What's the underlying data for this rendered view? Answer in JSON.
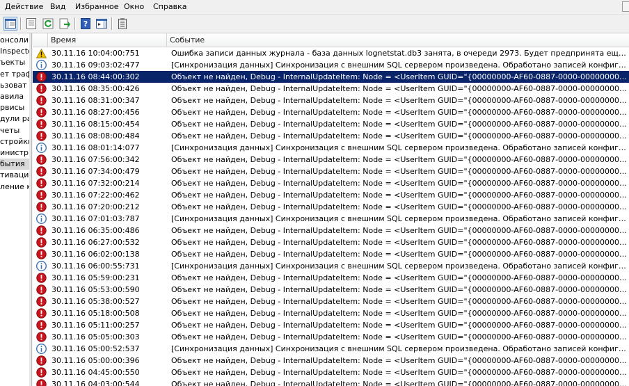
{
  "menu": [
    "Действие",
    "Вид",
    "Избранное",
    "Окно",
    "Справка"
  ],
  "toolbar": {
    "buttons": [
      "console-tree-icon",
      "properties-icon",
      "refresh-icon",
      "export-list-icon",
      "help-icon",
      "action-pane-icon",
      "clipboard-icon"
    ]
  },
  "tree": {
    "items": [
      "онсоли",
      "Inspecto",
      "ъекты",
      "ет траф",
      "ьзоват",
      "авила",
      "рвисы",
      "дули ра",
      "четы",
      "стройки",
      "инистр",
      "бытия",
      "тивация",
      "ление ко"
    ],
    "selected_index": 11
  },
  "columns": {
    "time": "Время",
    "event": "Событие"
  },
  "colors": {
    "selection": "#0a246a",
    "warning": "#f2c200",
    "error": "#c8141d",
    "info": "#3f6fb0"
  },
  "selected_row": 2,
  "rows": [
    {
      "type": "warning",
      "time": "30.11.16 10:04:00:751",
      "message": "Ошибка записи данных журнала - база данных lognetstat.db3 занята, в очереди 2973. Будет предпринята еще одна попыт..."
    },
    {
      "type": "info",
      "time": "30.11.16 09:03:02:477",
      "message": "[Синхронизация данных] Синхронизация с внешним SQL сервером произведена. Обработано записей конфигураци ..."
    },
    {
      "type": "error",
      "time": "30.11.16 08:44:00:302",
      "message": "Объект не найден, Debug - InternalUpdateItem: Node = <UserItem GUID=\"{00000000-AF60-0887-0000-000000000000}\"/>"
    },
    {
      "type": "error",
      "time": "30.11.16 08:35:00:426",
      "message": "Объект не найден, Debug - InternalUpdateItem: Node = <UserItem GUID=\"{00000000-AF60-0887-0000-000000000000}\"/>"
    },
    {
      "type": "error",
      "time": "30.11.16 08:31:00:347",
      "message": "Объект не найден, Debug - InternalUpdateItem: Node = <UserItem GUID=\"{00000000-AF60-0887-0000-000000000000}\"/>"
    },
    {
      "type": "error",
      "time": "30.11.16 08:27:00:456",
      "message": "Объект не найден, Debug - InternalUpdateItem: Node = <UserItem GUID=\"{00000000-AF60-0887-0000-000000000000}\"/>"
    },
    {
      "type": "error",
      "time": "30.11.16 08:15:00:454",
      "message": "Объект не найден, Debug - InternalUpdateItem: Node = <UserItem GUID=\"{00000000-AF60-0887-0000-000000000000}\"/>"
    },
    {
      "type": "error",
      "time": "30.11.16 08:08:00:484",
      "message": "Объект не найден, Debug - InternalUpdateItem: Node = <UserItem GUID=\"{00000000-AF60-0887-0000-000000000000}\"/>"
    },
    {
      "type": "info",
      "time": "30.11.16 08:01:14:077",
      "message": "[Синхронизация данных] Синхронизация с внешним SQL сервером произведена. Обработано записей конфигураци ..."
    },
    {
      "type": "error",
      "time": "30.11.16 07:56:00:342",
      "message": "Объект не найден, Debug - InternalUpdateItem: Node = <UserItem GUID=\"{00000000-AF60-0887-0000-000000000000}\"/>"
    },
    {
      "type": "error",
      "time": "30.11.16 07:34:00:479",
      "message": "Объект не найден, Debug - InternalUpdateItem: Node = <UserItem GUID=\"{00000000-AF60-0887-0000-000000000000}\"/>"
    },
    {
      "type": "error",
      "time": "30.11.16 07:32:00:214",
      "message": "Объект не найден, Debug - InternalUpdateItem: Node = <UserItem GUID=\"{00000000-AF60-0887-0000-000000000000}\"/>"
    },
    {
      "type": "error",
      "time": "30.11.16 07:22:00:462",
      "message": "Объект не найден, Debug - InternalUpdateItem: Node = <UserItem GUID=\"{00000000-AF60-0887-0000-000000000000}\"/>"
    },
    {
      "type": "error",
      "time": "30.11.16 07:20:00:212",
      "message": "Объект не найден, Debug - InternalUpdateItem: Node = <UserItem GUID=\"{00000000-AF60-0887-0000-000000000000}\"/>"
    },
    {
      "type": "info",
      "time": "30.11.16 07:01:03:787",
      "message": "[Синхронизация данных] Синхронизация с внешним SQL сервером произведена. Обработано записей конфигураци ..."
    },
    {
      "type": "error",
      "time": "30.11.16 06:35:00:486",
      "message": "Объект не найден, Debug - InternalUpdateItem: Node = <UserItem GUID=\"{00000000-AF60-0887-0000-000000000000}\"/>"
    },
    {
      "type": "error",
      "time": "30.11.16 06:27:00:532",
      "message": "Объект не найден, Debug - InternalUpdateItem: Node = <UserItem GUID=\"{00000000-AF60-0887-0000-000000000000}\"/>"
    },
    {
      "type": "error",
      "time": "30.11.16 06:02:00:138",
      "message": "Объект не найден, Debug - InternalUpdateItem: Node = <UserItem GUID=\"{00000000-AF60-0887-0000-000000000000}\"/>"
    },
    {
      "type": "info",
      "time": "30.11.16 06:00:55:731",
      "message": "[Синхронизация данных] Синхронизация с внешним SQL сервером произведена. Обработано записей конфигураци ..."
    },
    {
      "type": "error",
      "time": "30.11.16 05:59:00:231",
      "message": "Объект не найден, Debug - InternalUpdateItem: Node = <UserItem GUID=\"{00000000-AF60-0887-0000-000000000000}\"/>"
    },
    {
      "type": "error",
      "time": "30.11.16 05:53:00:590",
      "message": "Объект не найден, Debug - InternalUpdateItem: Node = <UserItem GUID=\"{00000000-AF60-0887-0000-000000000000}\"/>"
    },
    {
      "type": "error",
      "time": "30.11.16 05:38:00:527",
      "message": "Объект не найден, Debug - InternalUpdateItem: Node = <UserItem GUID=\"{00000000-AF60-0887-0000-000000000000}\"/>"
    },
    {
      "type": "error",
      "time": "30.11.16 05:18:00:508",
      "message": "Объект не найден, Debug - InternalUpdateItem: Node = <UserItem GUID=\"{00000000-AF60-0887-0000-000000000000}\"/>"
    },
    {
      "type": "error",
      "time": "30.11.16 05:11:00:257",
      "message": "Объект не найден, Debug - InternalUpdateItem: Node = <UserItem GUID=\"{00000000-AF60-0887-0000-000000000000}\"/>"
    },
    {
      "type": "error",
      "time": "30.11.16 05:05:00:303",
      "message": "Объект не найден, Debug - InternalUpdateItem: Node = <UserItem GUID=\"{00000000-AF60-0887-0000-000000000000}\"/>"
    },
    {
      "type": "info",
      "time": "30.11.16 05:00:52:537",
      "message": "[Синхронизация данных] Синхронизация с внешним SQL сервером произведена. Обработано записей конфигураци ..."
    },
    {
      "type": "error",
      "time": "30.11.16 05:00:00:396",
      "message": "Объект не найден, Debug - InternalUpdateItem: Node = <UserItem GUID=\"{00000000-AF60-0887-0000-000000000000}\"/>"
    },
    {
      "type": "error",
      "time": "30.11.16 04:45:00:550",
      "message": "Объект не найден, Debug - InternalUpdateItem: Node = <UserItem GUID=\"{00000000-AF60-0887-0000-000000000000}\"/>"
    },
    {
      "type": "error",
      "time": "30.11.16 04:03:00:544",
      "message": "Объект не найден, Debug - InternalUpdateItem: Node = <UserItem GUID=\"{00000000-AF60-0887-0000-000000000000}\"/>"
    }
  ]
}
